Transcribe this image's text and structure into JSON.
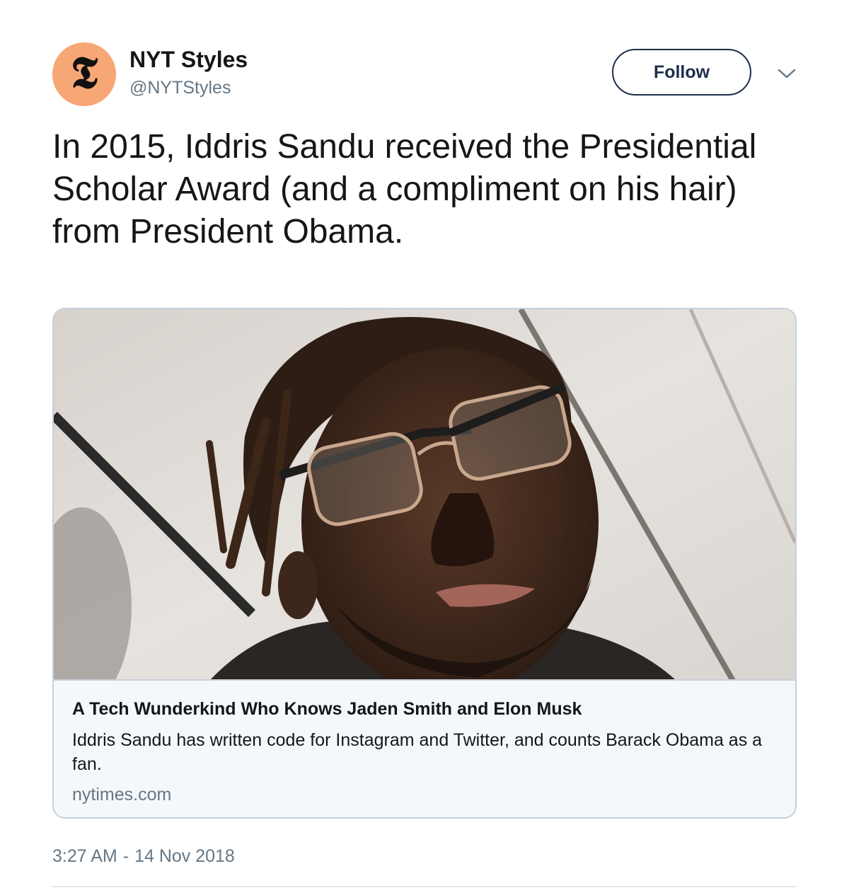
{
  "author": {
    "display_name": "NYT Styles",
    "handle": "@NYTStyles",
    "avatar_glyph": "𝕿",
    "avatar_color": "#f7a775"
  },
  "follow_button": {
    "label": "Follow"
  },
  "menu": {
    "icon": "chevron-down-icon"
  },
  "tweet": {
    "text": "In 2015, Iddris Sandu received the Presidential Scholar Award (and a compliment on his hair) from President Obama."
  },
  "card": {
    "title": "A Tech Wunderkind Who Knows Jaden Smith and Elon Musk",
    "description": "Iddris Sandu has written code for Instagram and Twitter, and counts Barack Obama as a fan.",
    "domain": "nytimes.com"
  },
  "timestamp": {
    "time": "3:27 AM",
    "separator": "-",
    "date": "14 Nov 2018"
  },
  "colors": {
    "text_primary": "#14171a",
    "text_secondary": "#657786",
    "follow_border": "#1c2f49",
    "card_border": "#c7d0d8",
    "card_background": "#f5f8fa"
  }
}
